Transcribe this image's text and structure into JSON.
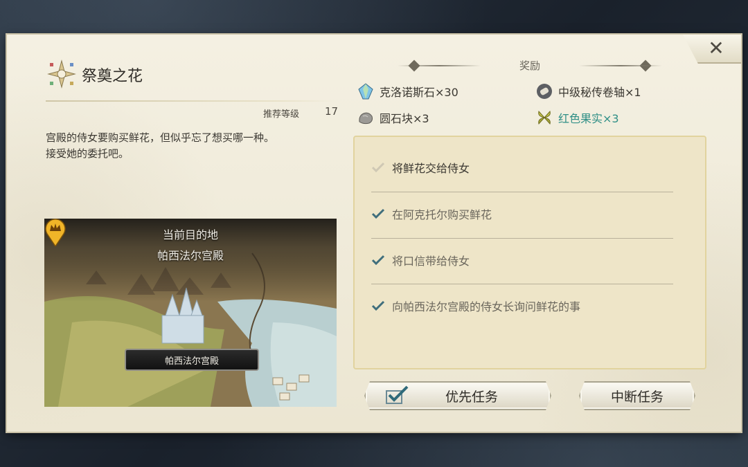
{
  "quest": {
    "title": "祭奠之花",
    "level_label": "推荐等级",
    "level_value": "17",
    "description": [
      "宫殿的侍女要购买鲜花，但似乎忘了想买哪一种。",
      "接受她的委托吧。"
    ]
  },
  "map": {
    "destination_heading": "当前目的地",
    "destination_name": "帕西法尔宫殿",
    "pin_label": "帕西法尔宫殿"
  },
  "rewards": {
    "title": "奖励",
    "items": [
      {
        "icon": "gem-icon",
        "label": "克洛诺斯石×30",
        "highlight": false
      },
      {
        "icon": "scroll-icon",
        "label": "中级秘传卷轴×1",
        "highlight": false
      },
      {
        "icon": "stone-icon",
        "label": "圆石块×3",
        "highlight": false
      },
      {
        "icon": "fruit-icon",
        "label": "红色果实×3",
        "highlight": true
      }
    ]
  },
  "objectives": [
    {
      "text": "将鲜花交给侍女",
      "status": "current"
    },
    {
      "text": "在阿克托尔购买鲜花",
      "status": "done"
    },
    {
      "text": "将口信带给侍女",
      "status": "done"
    },
    {
      "text": "向帕西法尔宫殿的侍女长询问鲜花的事",
      "status": "done"
    }
  ],
  "buttons": {
    "priority": "优先任务",
    "abort": "中断任务"
  },
  "colors": {
    "panel": "#f1ecdc",
    "objective_box": "#eee5c8",
    "highlight_text": "#2f8f86",
    "done_check": "#3f6e7c",
    "current_check": "#cfc8b4"
  }
}
